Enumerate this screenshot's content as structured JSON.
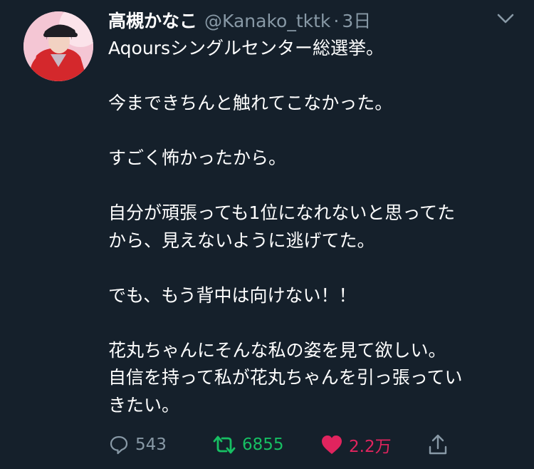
{
  "tweet": {
    "display_name": "高槻かなこ",
    "handle": "@Kanako_tktk",
    "separator": "·",
    "time": "3日",
    "lines": [
      "Aqoursシングルセンター総選挙。",
      "",
      "今まできちんと触れてこなかった。",
      "",
      "すごく怖かったから。",
      "",
      "自分が頑張っても1位になれないと思ってた",
      "から、見えないように逃げてた。",
      "",
      "でも、もう背中は向けない！！",
      "",
      "花丸ちゃんにそんな私の姿を見て欲しい。",
      "自信を持って私が花丸ちゃんを引っ張ってい",
      "きたい。"
    ]
  },
  "actions": {
    "reply": {
      "icon": "reply-icon",
      "count": "543"
    },
    "retweet": {
      "icon": "retweet-icon",
      "count": "6855",
      "active": true
    },
    "like": {
      "icon": "heart-icon",
      "count": "2.2万",
      "active": true
    },
    "share": {
      "icon": "share-icon"
    }
  },
  "colors": {
    "background": "#15202b",
    "text": "#ffffff",
    "secondary": "#8899a6",
    "retweet_active": "#17bf63",
    "like_active": "#e0245e"
  }
}
